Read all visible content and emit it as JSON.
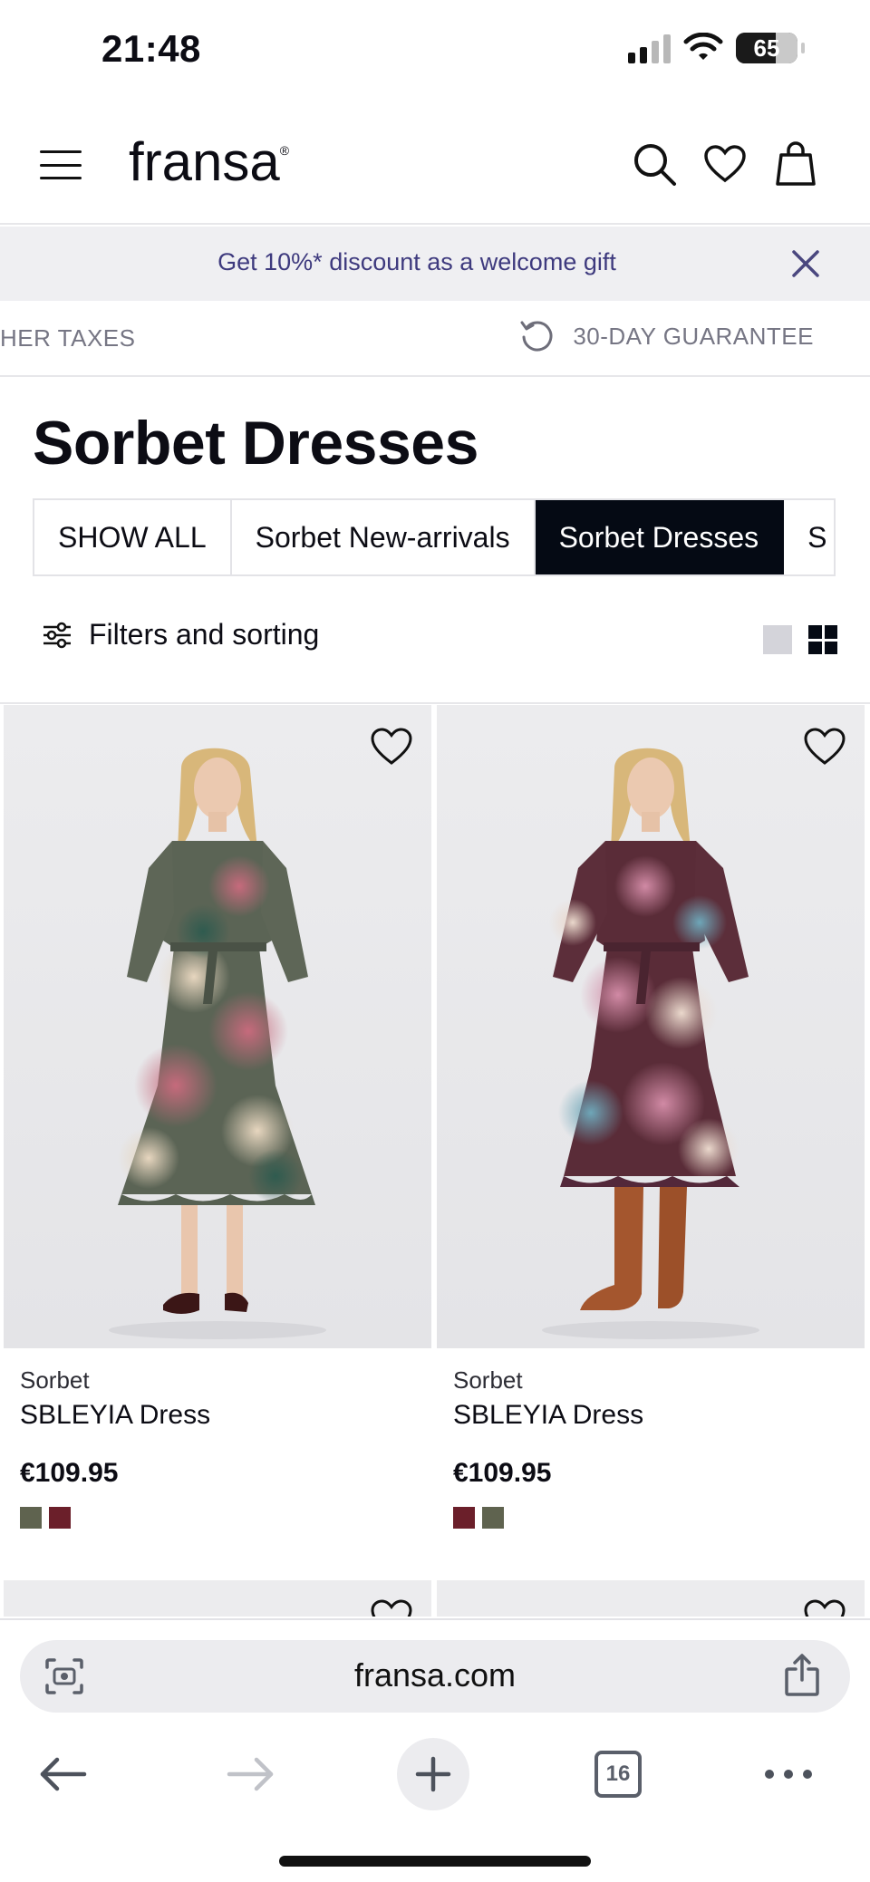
{
  "status_bar": {
    "time": "21:48",
    "battery": "65"
  },
  "header": {
    "logo": "fransa",
    "icons": [
      "menu-icon",
      "search-icon",
      "heart-icon",
      "bag-icon"
    ]
  },
  "promo": {
    "text": "Get 10%* discount as a welcome gift"
  },
  "info_strip": {
    "left_text": "HER TAXES",
    "right_text": "30-DAY GUARANTEE"
  },
  "page": {
    "title": "Sorbet Dresses"
  },
  "category_tabs": [
    {
      "label": "SHOW ALL",
      "active": false
    },
    {
      "label": "Sorbet New-arrivals",
      "active": false
    },
    {
      "label": "Sorbet Dresses",
      "active": true
    },
    {
      "label": "S",
      "active": false
    }
  ],
  "filters": {
    "label": "Filters and sorting"
  },
  "products": [
    {
      "brand": "Sorbet",
      "name": "SBLEYIA Dress",
      "price": "€109.95",
      "swatches": [
        "#5f634f",
        "#6b1f2a"
      ],
      "dress_base": "#5b6455",
      "dress_flower": "#b35a6b",
      "footwear": "loafers"
    },
    {
      "brand": "Sorbet",
      "name": "SBLEYIA Dress",
      "price": "€109.95",
      "swatches": [
        "#6b1f2a",
        "#5f634f"
      ],
      "dress_base": "#5a2c38",
      "dress_flower": "#c98aa4",
      "footwear": "boots"
    }
  ],
  "browser": {
    "url": "fransa.com",
    "tab_count": "16"
  },
  "colors": {
    "promo_text": "#3e3a7e",
    "active_tab": "#050a14",
    "muted_text": "#767684"
  }
}
